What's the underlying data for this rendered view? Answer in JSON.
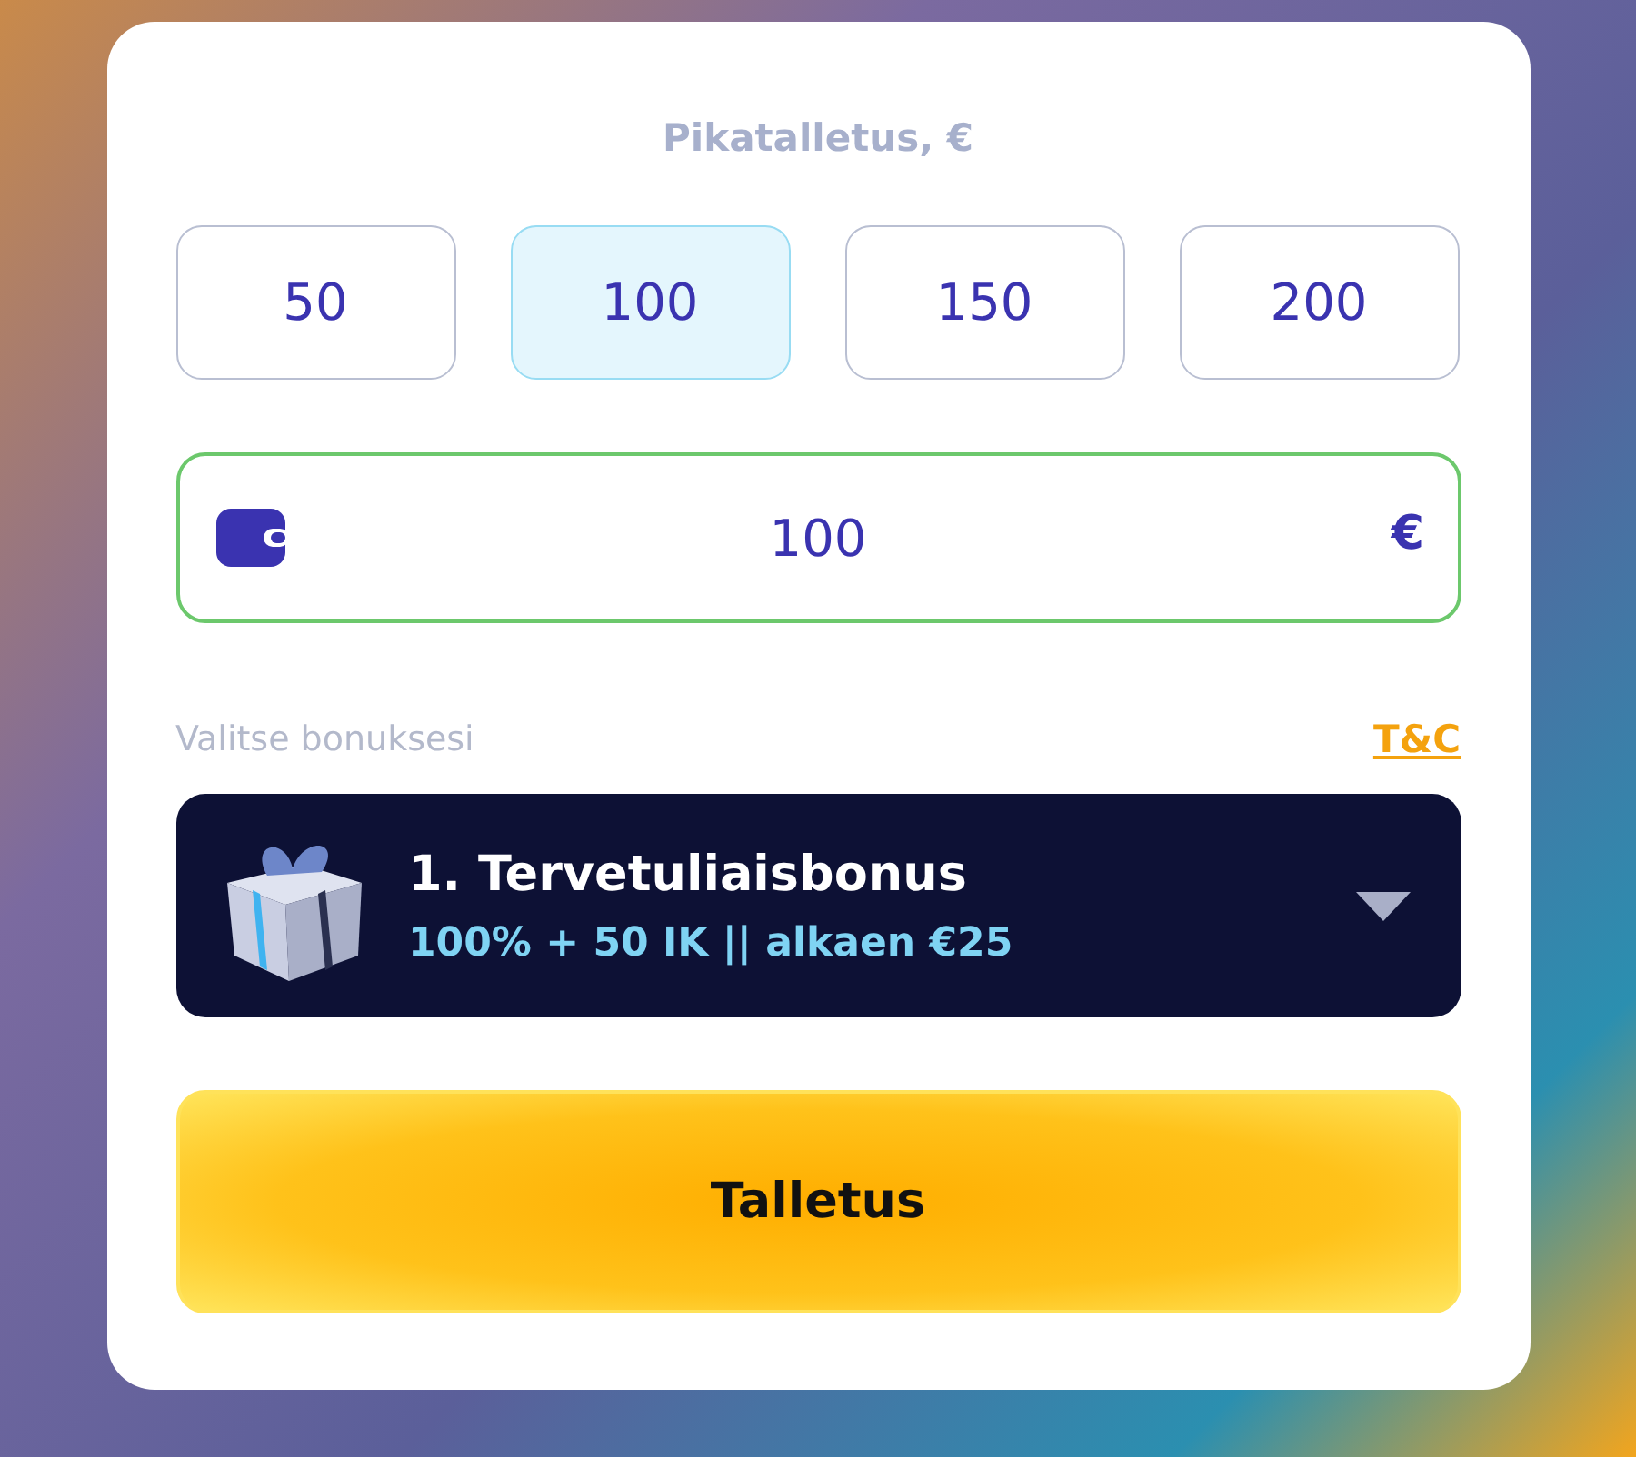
{
  "title": "Pikatalletus, €",
  "quick_amounts": [
    {
      "label": "50",
      "selected": false
    },
    {
      "label": "100",
      "selected": true
    },
    {
      "label": "150",
      "selected": false
    },
    {
      "label": "200",
      "selected": false
    }
  ],
  "amount_field": {
    "value": "100",
    "currency": "€"
  },
  "bonus_label": "Valitse bonuksesi",
  "terms_link": "T&C",
  "bonus_select": {
    "title": "1. Tervetuliaisbonus",
    "subtitle": "100% + 50 IK || alkaen €25"
  },
  "deposit_button": "Talletus"
}
